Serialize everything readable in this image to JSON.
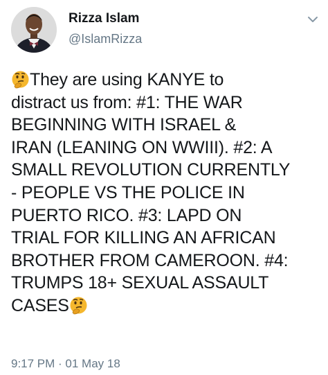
{
  "author": {
    "display_name": "Rizza Islam",
    "handle": "@IslamRizza"
  },
  "icons": {
    "avatar": "profile-photo",
    "menu": "chevron-down-icon",
    "emoji": "thinking-face-emoji"
  },
  "tweet": {
    "lines": [
      "They are using KANYE to",
      "distract us from: #1: THE WAR",
      "BEGINNING WITH ISRAEL &",
      "IRAN (LEANING ON WWIII). #2: A",
      "SMALL REVOLUTION CURRENTLY",
      "- PEOPLE VS THE POLICE IN",
      "PUERTO RICO. #3: LAPD ON",
      "TRIAL FOR KILLING AN AFRICAN",
      "BROTHER FROM CAMEROON. #4:",
      "TRUMPS 18+ SEXUAL ASSAULT",
      "CASES"
    ],
    "timestamp": "9:17 PM · 01 May 18"
  },
  "colors": {
    "text": "#14171a",
    "secondary": "#657786",
    "emoji_face": "#f5b72d"
  }
}
